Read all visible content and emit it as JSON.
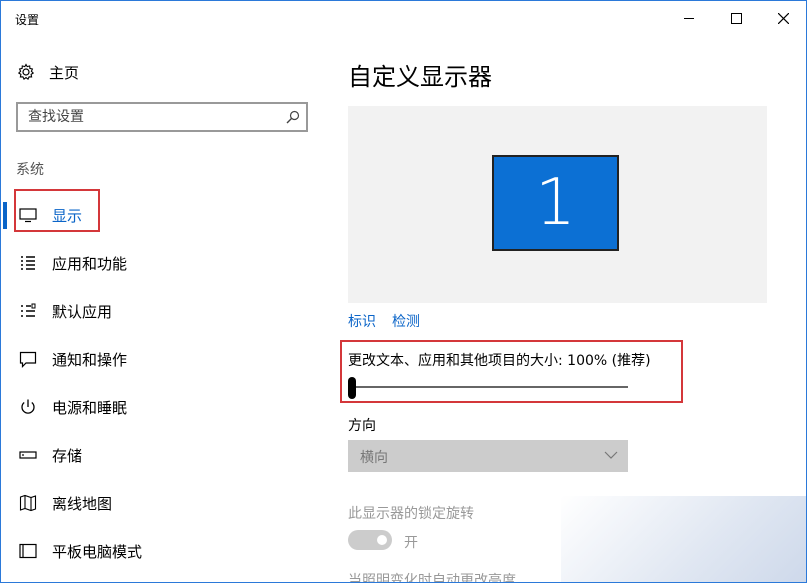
{
  "window": {
    "title": "设置"
  },
  "sidebar": {
    "home_label": "主页",
    "search_placeholder": "查找设置",
    "section": "系统",
    "items": [
      {
        "label": "显示",
        "icon": "monitor-icon",
        "active": true
      },
      {
        "label": "应用和功能",
        "icon": "list-icon"
      },
      {
        "label": "默认应用",
        "icon": "default-apps-icon"
      },
      {
        "label": "通知和操作",
        "icon": "notification-icon"
      },
      {
        "label": "电源和睡眠",
        "icon": "power-icon"
      },
      {
        "label": "存储",
        "icon": "storage-icon"
      },
      {
        "label": "离线地图",
        "icon": "map-icon"
      },
      {
        "label": "平板电脑模式",
        "icon": "tablet-icon"
      }
    ]
  },
  "main": {
    "title": "自定义显示器",
    "monitor_number": "1",
    "identify_link": "标识",
    "detect_link": "检测",
    "scale_label": "更改文本、应用和其他项目的大小: 100% (推荐)",
    "scale_slider_fraction": 0.0,
    "orientation_label": "方向",
    "orientation_value": "横向",
    "rotation_lock_label": "此显示器的锁定旋转",
    "rotation_lock_state": "开",
    "cut_off_text": "当照明变化时自动更改亮度"
  },
  "colors": {
    "accent": "#0a64c8",
    "monitor": "#0c70d4",
    "highlight": "#d4373a"
  }
}
